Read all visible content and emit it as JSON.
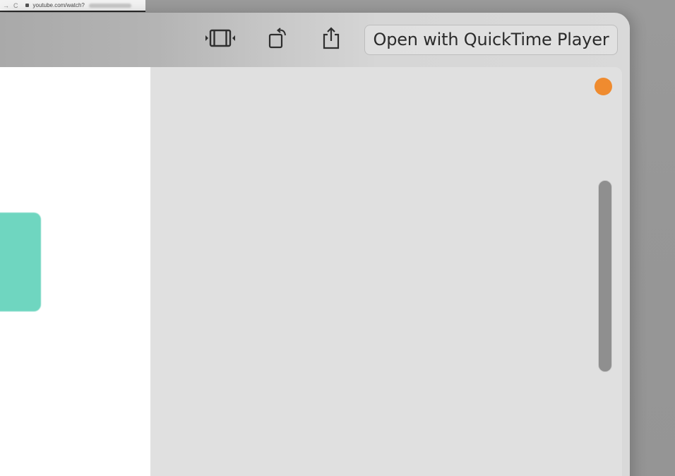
{
  "background_browser": {
    "nav_back": "→",
    "nav_reload": "C",
    "url": "youtube.com/watch?"
  },
  "toolbar": {
    "trim_icon": "trim-video-icon",
    "rotate_icon": "rotate-icon",
    "share_icon": "share-icon",
    "open_button_label": "Open with QuickTime Player"
  },
  "colors": {
    "accent_teal": "#6fd6c0",
    "record_dot": "#ef8b2f",
    "content_bg": "#e0e0e0",
    "left_panel_bg": "#ffffff"
  }
}
